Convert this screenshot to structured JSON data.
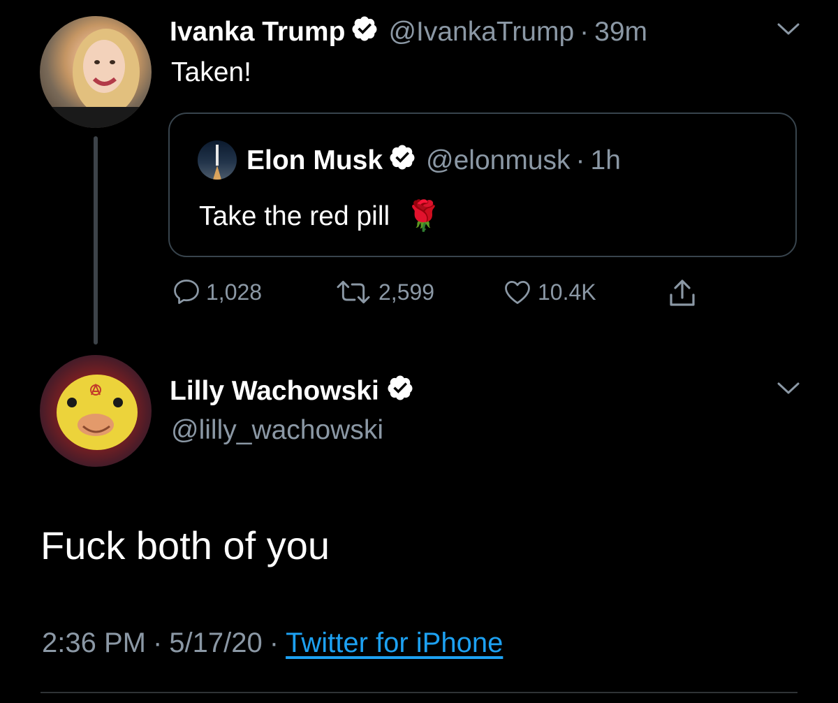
{
  "colors": {
    "background": "#000000",
    "muted": "#8b98a5",
    "link": "#1da1f2",
    "thread_line": "#3d4349",
    "quote_border": "#38444d"
  },
  "first_tweet": {
    "author_name": "Ivanka Trump",
    "handle": "@IvankaTrump",
    "separator": "·",
    "time": "39m",
    "text": "Taken!",
    "quoted": {
      "author_name": "Elon Musk",
      "handle": "@elonmusk",
      "separator": "·",
      "time": "1h",
      "text": "Take the red pill",
      "emoji": "🌹"
    },
    "actions": {
      "replies": "1,028",
      "retweets": "2,599",
      "likes": "10.4K"
    }
  },
  "reply_tweet": {
    "author_name": "Lilly Wachowski",
    "handle": "@lilly_wachowski",
    "text": "Fuck both of you",
    "date": "2:36 PM",
    "day": "5/17/20",
    "separator": "·",
    "source": "Twitter for iPhone"
  }
}
